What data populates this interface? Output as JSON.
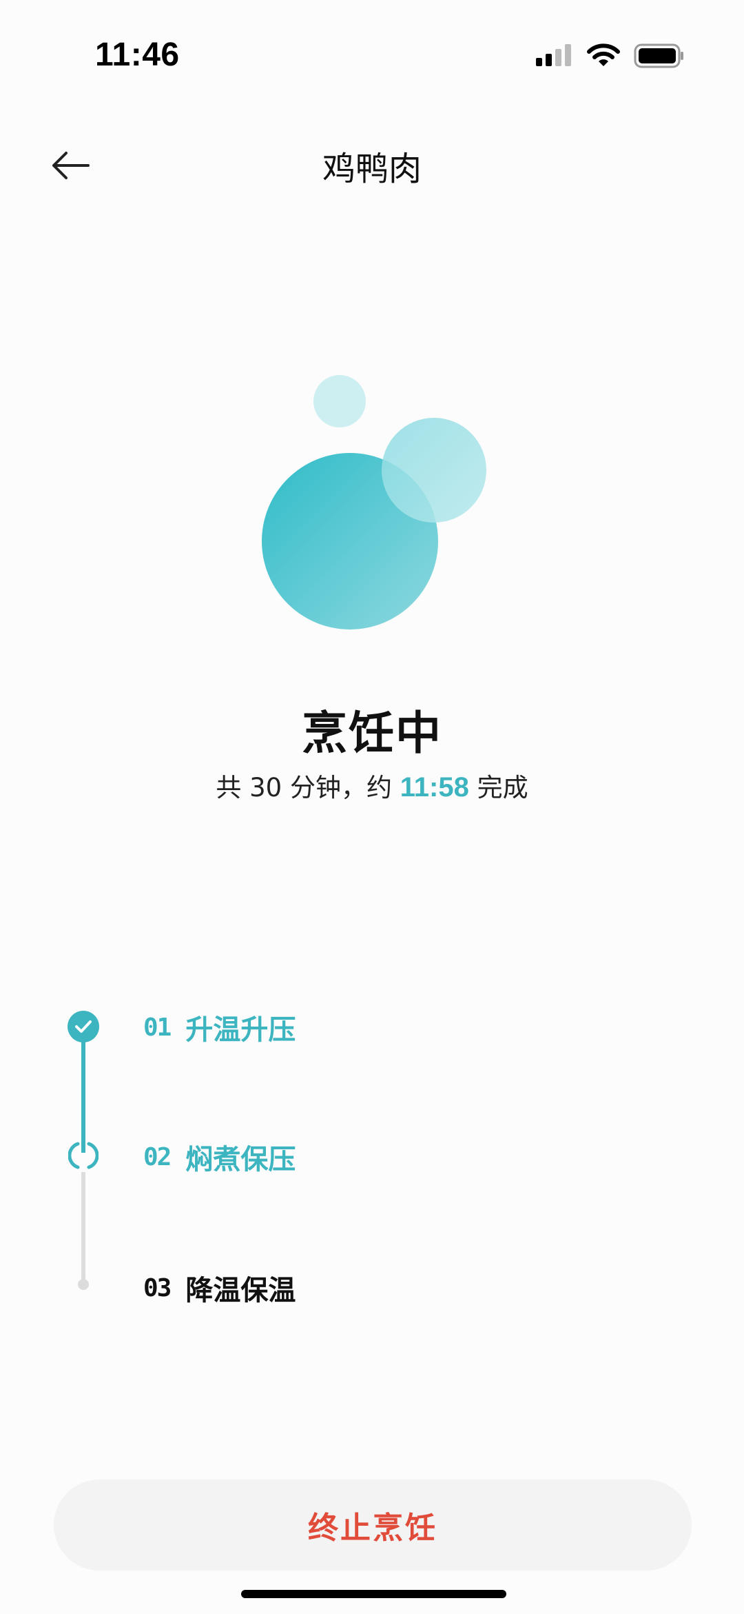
{
  "status_bar": {
    "time": "11:46",
    "icons": [
      "cellular-signal-icon",
      "wifi-icon",
      "battery-icon"
    ]
  },
  "header": {
    "back_icon": "arrow-left-icon",
    "title": "鸡鸭肉"
  },
  "cooking": {
    "status": "烹饪中",
    "summary_prefix": "共 30 分钟，约 ",
    "eta": "11:58",
    "summary_suffix": " 完成"
  },
  "steps": [
    {
      "number": "01",
      "label": "升温升压",
      "state": "done"
    },
    {
      "number": "02",
      "label": "焖煮保压",
      "state": "active"
    },
    {
      "number": "03",
      "label": "降温保温",
      "state": "pending"
    }
  ],
  "actions": {
    "stop_label": "终止烹饪"
  },
  "colors": {
    "accent": "#3DB5C0",
    "danger": "#E04B3A",
    "button_bg": "#F3F3F3",
    "pending": "#DDDDDD"
  }
}
